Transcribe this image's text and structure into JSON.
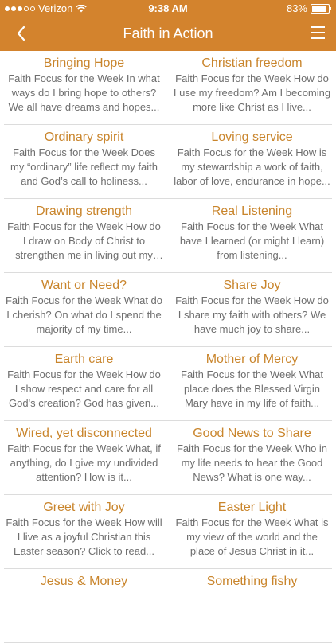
{
  "status": {
    "carrier": "Verizon",
    "time": "9:38 AM",
    "battery": "83%",
    "battery_level": 0.83
  },
  "nav": {
    "title": "Faith in Action",
    "back_icon": "chevron-left-icon",
    "menu_icon": "hamburger-menu-icon"
  },
  "items": [
    {
      "title": "Bringing Hope",
      "desc": "Faith Focus for the Week In what ways do I bring hope to others?   We all have dreams and hopes..."
    },
    {
      "title": "Christian freedom",
      "desc": "Faith Focus for the Week How do I use my freedom? Am I becoming more like Christ as I live..."
    },
    {
      "title": "Ordinary spirit",
      "desc": "Faith Focus for the Week Does my “ordinary” life reflect my faith and God’s call to holiness..."
    },
    {
      "title": "Loving service",
      "desc": "Faith Focus for the Week How is my stewardship a work of faith, labor of love, endurance in hope..."
    },
    {
      "title": "Drawing strength",
      "desc": "Faith Focus for the Week How do I draw on Body of Christ to strengthen me in living out my faith..."
    },
    {
      "title": "Real Listening",
      "desc": "Faith Focus for the Week                What have I learned (or might I learn) from listening..."
    },
    {
      "title": "Want or Need?",
      "desc": "Faith Focus for the Week What do I cherish? On what do I spend the majority of my time..."
    },
    {
      "title": "Share Joy",
      "desc": "Faith Focus for the Week How do I share my faith with others? We have much joy to share..."
    },
    {
      "title": "Earth care",
      "desc": "Faith Focus for the Week How do I show respect and care for all God's creation? God has given..."
    },
    {
      "title": "Mother of Mercy",
      "desc": "Faith Focus for the Week What place does the Blessed Virgin Mary have in my life of faith..."
    },
    {
      "title": "Wired, yet disconnected",
      "desc": "Faith Focus for the Week What, if anything, do I give my undivided attention? How is it..."
    },
    {
      "title": "Good News to Share",
      "desc": "Faith Focus for the Week Who in my life needs to hear the Good News? What is one way..."
    },
    {
      "title": "Greet with Joy",
      "desc": "Faith Focus for the Week How will I live as a joyful Christian this Easter season? Click to read..."
    },
    {
      "title": "Easter Light",
      "desc": "Faith Focus for the Week What is my view of the world and the place of Jesus Christ in it..."
    },
    {
      "title": "Jesus & Money",
      "desc": ""
    },
    {
      "title": "Something fishy",
      "desc": ""
    }
  ]
}
